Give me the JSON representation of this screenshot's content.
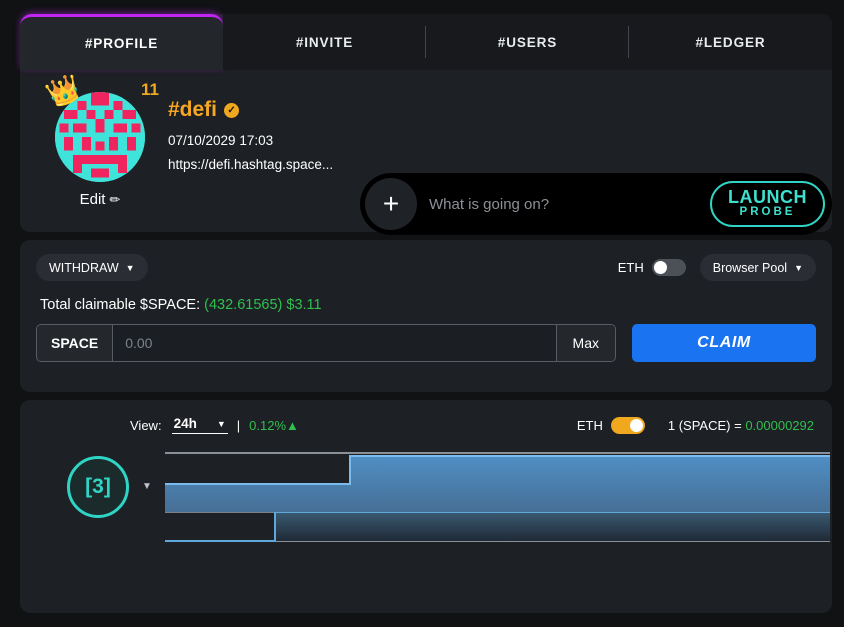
{
  "tabs": [
    {
      "label": "#PROFILE",
      "active": true,
      "name": "tab-profile"
    },
    {
      "label": "#INVITE",
      "active": false,
      "name": "tab-invite"
    },
    {
      "label": "#USERS",
      "active": false,
      "name": "tab-users"
    },
    {
      "label": "#LEDGER",
      "active": false,
      "name": "tab-ledger"
    }
  ],
  "profile": {
    "level_badge": "11",
    "crown_icon": "crown-icon",
    "handle": "#defi",
    "verified_mark": "✓",
    "date": "07/10/2029 17:03",
    "link": "https://defi.hashtag.space...",
    "edit_label": "Edit",
    "edit_icon": "✏",
    "settings_icon": "gear-icon"
  },
  "composer": {
    "plus_label": "+",
    "placeholder": "What is going on?",
    "value": "",
    "launch_line1": "LAUNCH",
    "launch_line2": "PROBE"
  },
  "claim": {
    "mode_label": "WITHDRAW",
    "eth_label": "ETH",
    "eth_toggle_on": false,
    "pool_label": "Browser Pool",
    "claimable_prefix": "Total claimable $SPACE:",
    "claimable_amount": "(432.61565)",
    "claimable_usd": "$3.11",
    "token_label": "SPACE",
    "amount_placeholder": "0.00",
    "amount_value": "",
    "max_label": "Max",
    "claim_label": "CLAIM"
  },
  "chart_header": {
    "view_label": "View:",
    "view_value": "24h",
    "separator": "|",
    "change_pct": "0.12%▲",
    "eth_label": "ETH",
    "eth_toggle_on": true,
    "rate_prefix": "1 (SPACE) =",
    "rate_value": "0.00000292"
  },
  "chart_data": {
    "type": "area",
    "title": "",
    "xlabel": "",
    "ylabel": "",
    "grid": true,
    "legend": "none",
    "badge": "[3]",
    "x": [
      0,
      0.168,
      0.278,
      1
    ],
    "xlim": [
      0,
      1
    ],
    "ylim": [
      0,
      4
    ],
    "gridlines": [
      0,
      1,
      2,
      3
    ],
    "series": [
      {
        "name": "lower-band",
        "step": "post",
        "values": [
          0,
          1,
          1,
          1
        ],
        "color": "#2c3e50",
        "line_color": "#5fa8dc"
      },
      {
        "name": "upper-band",
        "step": "post",
        "values": [
          1,
          1,
          2,
          2
        ],
        "color": "#4a7fb5",
        "line_color": "#6fb2e8"
      }
    ]
  },
  "colors": {
    "accent_magenta": "#c026f0",
    "accent_teal": "#2fd4c4",
    "accent_gold": "#f0a81e",
    "accent_green": "#2fbf4f",
    "accent_blue": "#1a73f0"
  }
}
